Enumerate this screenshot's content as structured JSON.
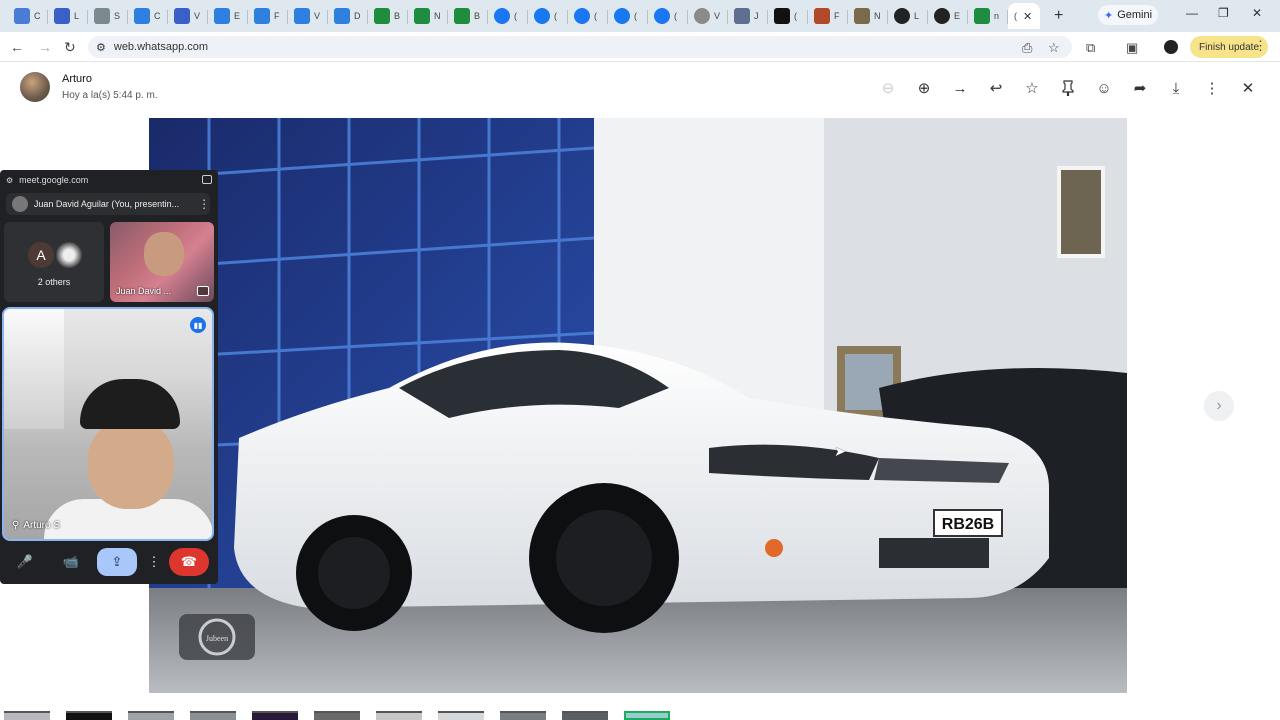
{
  "browser": {
    "tabs": [
      {
        "icon": "bookmark-icon",
        "letter": "",
        "color": "#4a7bd6",
        "short": "C"
      },
      {
        "icon": "bookmark-icon",
        "letter": "",
        "color": "#3b5fc9",
        "short": "L"
      },
      {
        "icon": "pin-icon",
        "letter": "",
        "color": "#7a8a8f",
        "short": "S"
      },
      {
        "icon": "cloud-icon",
        "letter": "",
        "color": "#2f7fe0",
        "short": "C"
      },
      {
        "icon": "list-icon",
        "letter": "",
        "color": "#3b5fc9",
        "short": "V"
      },
      {
        "icon": "cloud-icon",
        "letter": "",
        "color": "#2f7fe0",
        "short": "E"
      },
      {
        "icon": "cloud-icon",
        "letter": "",
        "color": "#2f7fe0",
        "short": "F"
      },
      {
        "icon": "cloud-icon",
        "letter": "",
        "color": "#2f7fe0",
        "short": "V"
      },
      {
        "icon": "cloud-icon",
        "letter": "",
        "color": "#2f7fe0",
        "short": "D"
      },
      {
        "icon": "sheet-icon",
        "letter": "",
        "color": "#1e8e3e",
        "short": "B"
      },
      {
        "icon": "sheet-icon",
        "letter": "",
        "color": "#1e8e3e",
        "short": "N"
      },
      {
        "icon": "sheet-icon",
        "letter": "",
        "color": "#1e8e3e",
        "short": "B"
      },
      {
        "icon": "facebook-icon",
        "letter": "",
        "color": "#1877f2",
        "short": "("
      },
      {
        "icon": "facebook-icon",
        "letter": "",
        "color": "#1877f2",
        "short": "("
      },
      {
        "icon": "facebook-icon",
        "letter": "",
        "color": "#1877f2",
        "short": "("
      },
      {
        "icon": "facebook-icon",
        "letter": "",
        "color": "#1877f2",
        "short": "("
      },
      {
        "icon": "facebook-icon",
        "letter": "",
        "color": "#1877f2",
        "short": "("
      },
      {
        "icon": "globe-icon",
        "letter": "",
        "color": "#8a8a8a",
        "short": "V"
      },
      {
        "icon": "translate-icon",
        "letter": "",
        "color": "#5f6f8f",
        "short": "J"
      },
      {
        "icon": "x-icon",
        "letter": "",
        "color": "#111111",
        "short": "("
      },
      {
        "icon": "image-icon",
        "letter": "",
        "color": "#b04a2a",
        "short": "F"
      },
      {
        "icon": "person-icon",
        "letter": "",
        "color": "#7a6a4a",
        "short": "N"
      },
      {
        "icon": "avatar-icon",
        "letter": "",
        "color": "#222222",
        "short": "L"
      },
      {
        "icon": "avatar-icon",
        "letter": "",
        "color": "#222222",
        "short": "E"
      },
      {
        "icon": "k-icon",
        "letter": "",
        "color": "#1e8e3e",
        "short": "n"
      }
    ],
    "active_tab_short": "(",
    "active_tab_close": "✕",
    "new_tab": "+",
    "gemini_label": "Gemini",
    "gemini_star": "✦",
    "url": "web.whatsapp.com",
    "finish_update": "Finish update",
    "minimize": "—",
    "restore": "❐",
    "close": "✕"
  },
  "viewer": {
    "sender_name": "Arturo",
    "sender_time": "Hoy a la(s) 5:44 p. m.",
    "icons": {
      "zoom_out": "⊖",
      "zoom_in": "⊕",
      "forward_arrow": "→",
      "reply": "↩",
      "star": "☆",
      "pin": "📌",
      "emoji": "☺",
      "forward": "➦",
      "download": "⤓",
      "menu": "⋮",
      "close": "✕"
    },
    "next": "›",
    "plate_text": "RB26B",
    "watermark": "Jubeen"
  },
  "meet": {
    "url": "meet.google.com",
    "presenter": "Juan David Aguilar (You, presentin...",
    "others_initial": "A",
    "others_label": "2 others",
    "juan_label": "Juan David ...",
    "self_label": "Arturo S",
    "controls": {
      "mic": "🎤",
      "camera": "📹",
      "present": "⇪",
      "more": "⋮",
      "hangup": "☎"
    }
  }
}
